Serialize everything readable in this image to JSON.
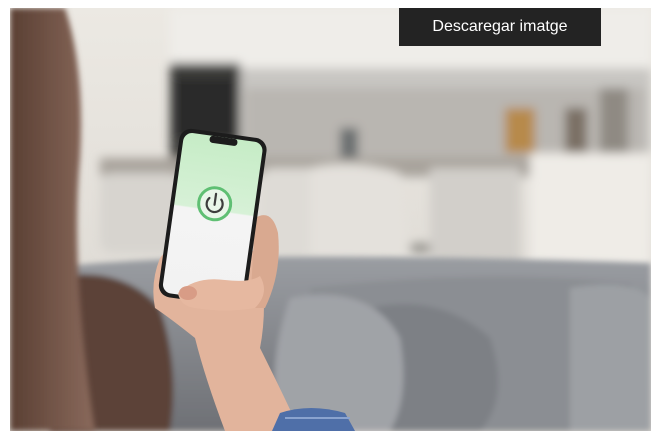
{
  "download_button": {
    "label": "Descaregar imatge"
  },
  "photo": {
    "description_icon": "phone-power-icon",
    "colors": {
      "wall": "#e6e3de",
      "sofa": "#8e9196",
      "screen_top": "#c8eec9",
      "power_ring": "#5fbf73"
    }
  }
}
